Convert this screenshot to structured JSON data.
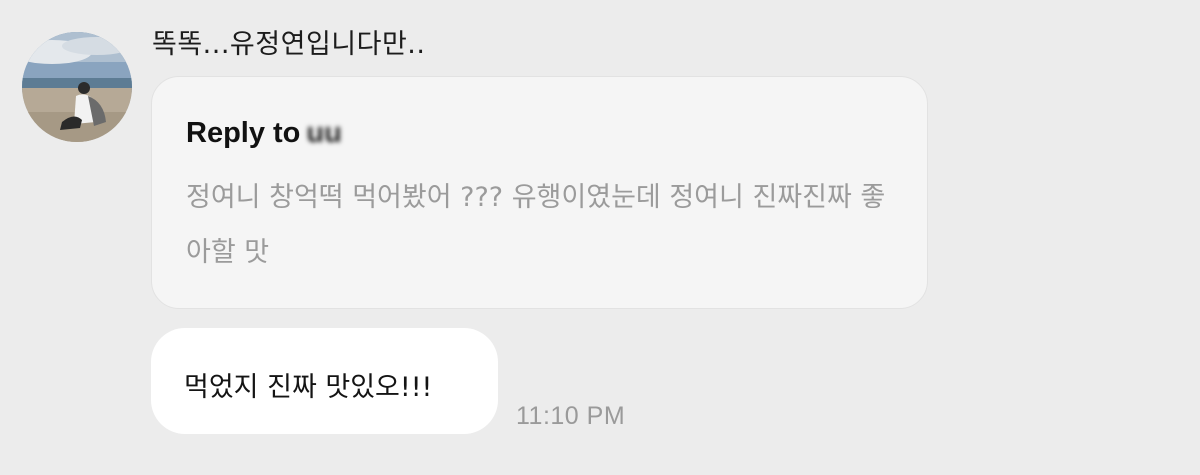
{
  "conversation": {
    "sender": {
      "avatar": "avatar-photo-beach",
      "text": "똑똑...유정연입니다만.."
    },
    "reply": {
      "prefix": "Reply to",
      "name": "uu",
      "quote": "정여니 창억떡 먹어봤어 ??? 유행이였눈데 정여니 진짜진짜 좋아할 맛"
    },
    "message": {
      "text": "먹었지 진짜 맛있오!!!",
      "time": "11:10 PM"
    }
  },
  "colors": {
    "background": "#ececec",
    "reply_card": "#f5f5f5",
    "bubble": "#ffffff",
    "quote_text": "#9b9b9b",
    "timestamp": "#9a9a9a"
  }
}
